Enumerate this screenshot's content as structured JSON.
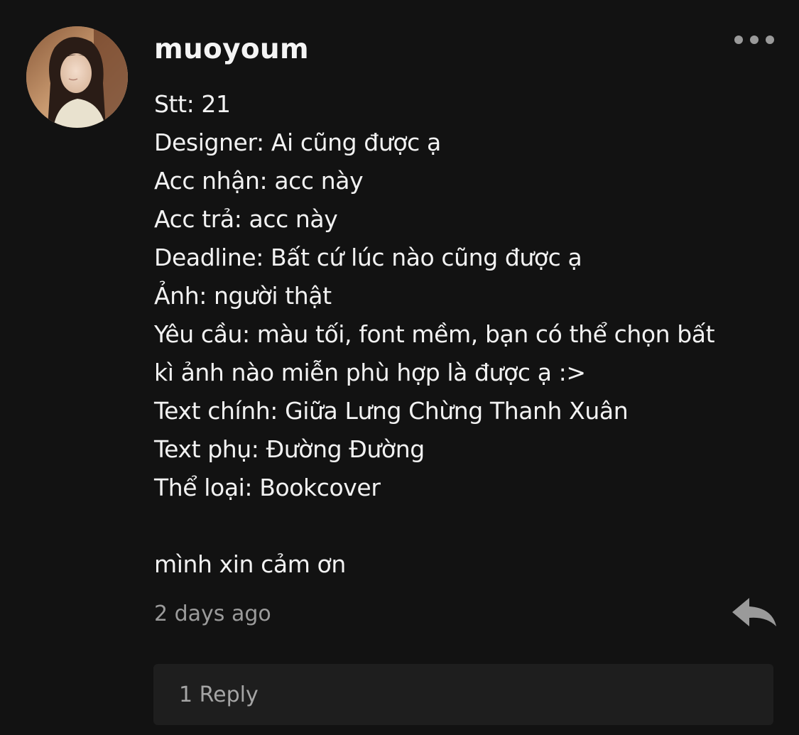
{
  "comment": {
    "username": "muoyoum",
    "lines": [
      "Stt: 21",
      "Designer: Ai cũng được ạ",
      "Acc nhận: acc này",
      "Acc trả: acc này",
      "Deadline: Bất cứ lúc nào cũng được ạ",
      "Ảnh: người thật",
      "Yêu cầu: màu tối, font mềm, bạn có thể chọn bất",
      "kì ảnh nào miễn phù hợp là được ạ :>",
      "Text chính: Giữa Lưng Chừng Thanh Xuân",
      "Text phụ: Đường Đường",
      "Thể loại: Bookcover",
      "",
      "mình xin cảm ơn"
    ],
    "timestamp": "2 days ago",
    "replies_label": "1 Reply"
  },
  "icons": {
    "more": "more-horizontal-icon",
    "reply": "reply-arrow-icon",
    "avatar": "user-avatar"
  },
  "colors": {
    "background": "#121212",
    "text": "#f2f2f2",
    "muted": "#9b9b9b",
    "reply_box": "#1e1e1e"
  }
}
